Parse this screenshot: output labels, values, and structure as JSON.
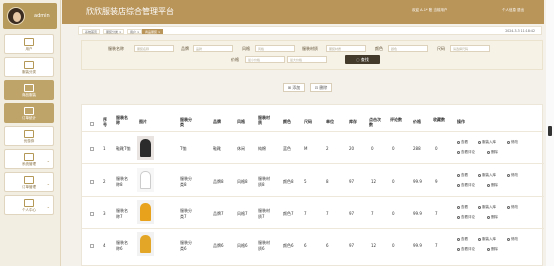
{
  "sidebar": {
    "admin": "admin",
    "items": [
      {
        "label": "用户",
        "icon": "user-icon"
      },
      {
        "label": "服装分类",
        "icon": "category-icon"
      },
      {
        "label": "商品服装",
        "icon": "clothes-icon"
      },
      {
        "label": "订单统计",
        "icon": "bar-chart-icon"
      },
      {
        "label": "优惠券",
        "icon": "grid-icon"
      },
      {
        "label": "系统管理",
        "icon": "system-icon"
      },
      {
        "label": "订单管理",
        "icon": "order-icon"
      },
      {
        "label": "个人中心",
        "icon": "profile-icon"
      }
    ]
  },
  "header": {
    "title": "欣欣服装店综合管理平台",
    "user_info": "欢迎 A-1* 账 当前用户",
    "personal": "个人信息 退出"
  },
  "crumbs": [
    "系统首页",
    "服装分类 ×",
    "用户 ×",
    "商品服装 ×"
  ],
  "clock": "2024-3-3 11:18:42",
  "filter": {
    "labels": [
      "服装名称",
      "品牌",
      "风格",
      "服装材质",
      "颜色",
      "尺码",
      "价格"
    ],
    "placeholders": [
      "服装名称",
      "品牌",
      "风格",
      "服装材质",
      "颜色",
      "请选择尺码",
      "最小价格",
      "最大价格"
    ],
    "search": "查找"
  },
  "actions": {
    "add": "添加",
    "delete": "删除"
  },
  "table": {
    "headers": [
      "序号",
      "服装名称",
      "图片",
      "服装分类",
      "品牌",
      "风格",
      "服装材质",
      "颜色",
      "尺码",
      "单位",
      "库存",
      "点击次数",
      "评论数",
      "价格",
      "收藏数",
      "操作"
    ],
    "rows": [
      {
        "no": "1",
        "name": "鞋靴T恤",
        "category": "T恤",
        "brand": "鞋靴",
        "style": "休闲",
        "material": "纯棉",
        "color": "蓝色",
        "size": "M",
        "unit": "2",
        "stock": "20",
        "clicks": "0",
        "reviews": "0",
        "price": "288",
        "favorites": "0",
        "thumb": "#e9e4e2",
        "fig": "#2b2b2b"
      },
      {
        "no": "2",
        "name": "服装名称8",
        "category": "服装分类8",
        "brand": "品牌8",
        "style": "风格8",
        "material": "服装材质8",
        "color": "颜色8",
        "size": "5",
        "unit": "8",
        "stock": "97",
        "clicks": "12",
        "reviews": "0",
        "price": "99.9",
        "favorites": "9",
        "thumb": "#f7f7f7",
        "fig": "#ffffff"
      },
      {
        "no": "3",
        "name": "服装名称7",
        "category": "服装分类7",
        "brand": "品牌7",
        "style": "风格7",
        "material": "服装材质7",
        "color": "颜色7",
        "size": "7",
        "unit": "7",
        "stock": "97",
        "clicks": "7",
        "reviews": "0",
        "price": "99.9",
        "favorites": "7",
        "thumb": "#f2f2f2",
        "fig": "#e8a21b"
      },
      {
        "no": "4",
        "name": "服装名称6",
        "category": "服装分类6",
        "brand": "品牌6",
        "style": "风格6",
        "material": "服装材质6",
        "color": "颜色6",
        "size": "6",
        "unit": "6",
        "stock": "97",
        "clicks": "12",
        "reviews": "0",
        "price": "99.9",
        "favorites": "7",
        "thumb": "#f2f2f2",
        "fig": "#e4a626"
      }
    ],
    "row_actions": [
      "查看",
      "服装入库",
      "修改",
      "查看评论",
      "删除"
    ]
  }
}
